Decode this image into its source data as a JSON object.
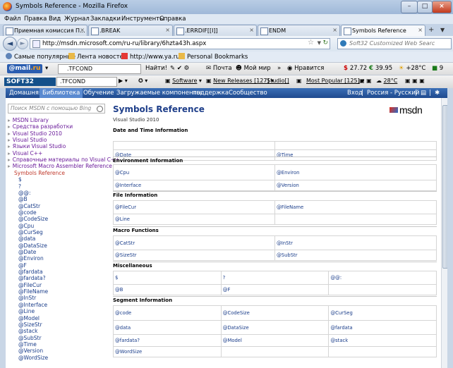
{
  "window": {
    "title": "Symbols Reference - Mozilla Firefox",
    "minimize": "–",
    "maximize": "□",
    "close": "×"
  },
  "menu": [
    "Файл",
    "Правка",
    "Вид",
    "Журнал",
    "Закладки",
    "Инструменты",
    "Справка"
  ],
  "tabs": [
    {
      "label": "Приемная комиссия П...",
      "active": false
    },
    {
      "label": ".BREAK",
      "active": false
    },
    {
      "label": ".ERRDIF[[I]]",
      "active": false
    },
    {
      "label": "ENDM",
      "active": false
    },
    {
      "label": "Symbols Reference",
      "active": true
    }
  ],
  "tab_new": "+",
  "nav": {
    "back": "◄",
    "forward": "►",
    "url": "http://msdn.microsoft.com/ru-ru/library/6hzta43h.aspx",
    "search_placeholder": "Soft32 Customized Web Searc"
  },
  "bookmarks": [
    "Самые популярные",
    "Лента новостей",
    "http://www.ya.ru/",
    "Personal Bookmarks"
  ],
  "mailbar": {
    "logo_main": "@mail",
    "logo_suffix": ".ru",
    "search_value": ".TFCOND",
    "find": "Найти!",
    "mail": "Почта",
    "world": "Мой мир",
    "likes": "Нравится",
    "usd": "27.72",
    "eur": "39.95",
    "temp": "+28°C",
    "count": "9"
  },
  "soft32bar": {
    "logo": "SOFT32",
    "search_value": ".TFCOND",
    "software": "Software",
    "new_releases": "New Releases [127]",
    "studio": "Studio[]",
    "most_popular": "Most Popular [125]",
    "temp": "28°C"
  },
  "msdn_nav": {
    "items": [
      "Домашняя",
      "Библиотека",
      "Обучение",
      "Загружаемые компоненты",
      "поддержка",
      "Сообщество"
    ],
    "active_index": 1,
    "login": "Вход",
    "region": "Россия - Русский"
  },
  "sidebar": {
    "search_placeholder": "Поиск MSDN с помощью Bing",
    "items": [
      {
        "label": "MSDN Library",
        "level": 0
      },
      {
        "label": "Средства разработки",
        "level": 0
      },
      {
        "label": "Visual Studio 2010",
        "level": 0
      },
      {
        "label": "Visual Studio",
        "level": 0
      },
      {
        "label": "Языки Visual Studio",
        "level": 0
      },
      {
        "label": "Visual C++",
        "level": 0
      },
      {
        "label": "Справочные материалы по Visual C++",
        "level": 0
      },
      {
        "label": "Microsoft Macro Assembler Reference",
        "level": 0
      },
      {
        "label": "Symbols Reference",
        "level": 1
      },
      {
        "label": "$",
        "level": 2
      },
      {
        "label": "?",
        "level": 2
      },
      {
        "label": "@@:",
        "level": 2
      },
      {
        "label": "@B",
        "level": 2
      },
      {
        "label": "@CatStr",
        "level": 2
      },
      {
        "label": "@code",
        "level": 2
      },
      {
        "label": "@CodeSize",
        "level": 2
      },
      {
        "label": "@Cpu",
        "level": 2
      },
      {
        "label": "@CurSeg",
        "level": 2
      },
      {
        "label": "@data",
        "level": 2
      },
      {
        "label": "@DataSize",
        "level": 2
      },
      {
        "label": "@Date",
        "level": 2
      },
      {
        "label": "@Environ",
        "level": 2
      },
      {
        "label": "@F",
        "level": 2
      },
      {
        "label": "@fardata",
        "level": 2
      },
      {
        "label": "@fardata?",
        "level": 2
      },
      {
        "label": "@FileCur",
        "level": 2
      },
      {
        "label": "@FileName",
        "level": 2
      },
      {
        "label": "@InStr",
        "level": 2
      },
      {
        "label": "@Interface",
        "level": 2
      },
      {
        "label": "@Line",
        "level": 2
      },
      {
        "label": "@Model",
        "level": 2
      },
      {
        "label": "@SizeStr",
        "level": 2
      },
      {
        "label": "@stack",
        "level": 2
      },
      {
        "label": "@SubStr",
        "level": 2
      },
      {
        "label": "@Time",
        "level": 2
      },
      {
        "label": "@Version",
        "level": 2
      },
      {
        "label": "@WordSize",
        "level": 2
      }
    ]
  },
  "content": {
    "title": "Symbols Reference",
    "subtitle": "Visual Studio 2010",
    "logo": "msdn",
    "sections": [
      {
        "heading": "Date and Time Information",
        "rows": [
          [
            "",
            ""
          ],
          [
            "@Date",
            "@Time"
          ]
        ]
      },
      {
        "heading": "Environment Information",
        "rows": [
          [
            "@Cpu",
            "@Environ"
          ],
          [
            "@Interface",
            "@Version"
          ]
        ]
      },
      {
        "heading": "File Information",
        "rows": [
          [
            "@FileCur",
            "@FileName"
          ],
          [
            "@Line",
            ""
          ]
        ]
      },
      {
        "heading": "Macro Functions",
        "rows": [
          [
            "@CatStr",
            "@InStr"
          ],
          [
            "@SizeStr",
            "@SubStr"
          ]
        ]
      },
      {
        "heading": "Miscellaneous",
        "rows": [
          [
            "$",
            "?",
            "@@:"
          ],
          [
            "@B",
            "@F",
            ""
          ]
        ]
      },
      {
        "heading": "Segment Information",
        "rows": [
          [
            "@code",
            "@CodeSize",
            "@CurSeg"
          ],
          [
            "@data",
            "@DataSize",
            "@fardata"
          ],
          [
            "@fardata?",
            "@Model",
            "@stack"
          ],
          [
            "@WordSize",
            "",
            ""
          ]
        ]
      }
    ]
  }
}
